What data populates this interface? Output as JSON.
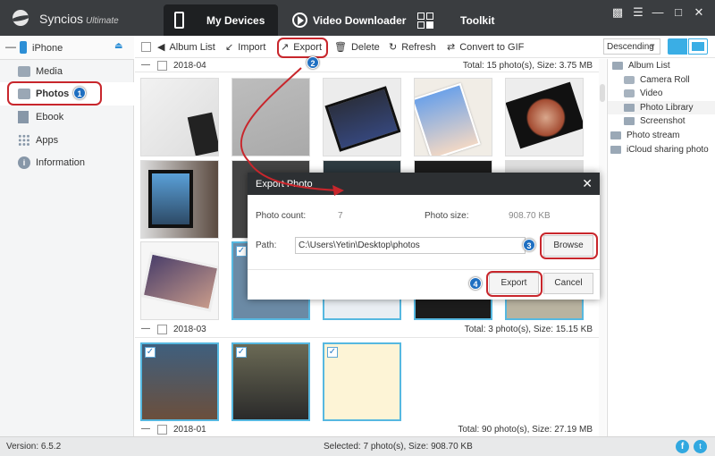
{
  "app": {
    "name": "Syncios",
    "edition": "Ultimate"
  },
  "nav": {
    "tabs": [
      {
        "label": "My Devices",
        "icon": "phone-icon",
        "active": true
      },
      {
        "label": "Video Downloader",
        "icon": "play-icon",
        "active": false
      },
      {
        "label": "Toolkit",
        "icon": "toolkit-grid-icon",
        "active": false
      }
    ]
  },
  "window_controls": [
    "feedback-icon",
    "menu-icon",
    "minimize-icon",
    "maximize-icon",
    "close-icon"
  ],
  "sidebar": {
    "device": "iPhone",
    "items": [
      {
        "label": "Media",
        "icon": "media-icon"
      },
      {
        "label": "Photos",
        "icon": "photos-icon",
        "active": true
      },
      {
        "label": "Ebook",
        "icon": "ebook-icon"
      },
      {
        "label": "Apps",
        "icon": "apps-icon"
      },
      {
        "label": "Information",
        "icon": "info-icon"
      }
    ]
  },
  "toolbar": {
    "album_list": "Album List",
    "import": "Import",
    "export": "Export",
    "delete": "Delete",
    "refresh": "Refresh",
    "convert_gif": "Convert to GIF",
    "sort": "Descending"
  },
  "groups": [
    {
      "date": "2018-04",
      "total": "Total: 15 photo(s), Size: 3.75 MB"
    },
    {
      "date": "2018-03",
      "total": "Total: 3 photo(s), Size: 15.15 KB"
    },
    {
      "date": "2018-01",
      "total": "Total: 90 photo(s), Size: 27.19 MB"
    }
  ],
  "albums": {
    "root": "Album List",
    "items": [
      "Camera Roll",
      "Video",
      "Photo Library",
      "Screenshot"
    ],
    "other": [
      "Photo stream",
      "iCloud sharing photo"
    ],
    "active": "Photo Library"
  },
  "dialog": {
    "title": "Export Photo",
    "count_label": "Photo count:",
    "count_value": "7",
    "size_label": "Photo size:",
    "size_value": "908.70 KB",
    "path_label": "Path:",
    "path_value": "C:\\Users\\Yetin\\Desktop\\photos",
    "browse": "Browse",
    "export": "Export",
    "cancel": "Cancel"
  },
  "steps": [
    "1",
    "2",
    "3",
    "4"
  ],
  "status": {
    "version": "Version: 6.5.2",
    "selected": "Selected: 7 photo(s), Size: 908.70 KB"
  },
  "colors": {
    "accent": "#1f6fc1",
    "highlight": "#c8262c",
    "titlebar": "#3a3d40",
    "selection": "#56b8e0"
  }
}
